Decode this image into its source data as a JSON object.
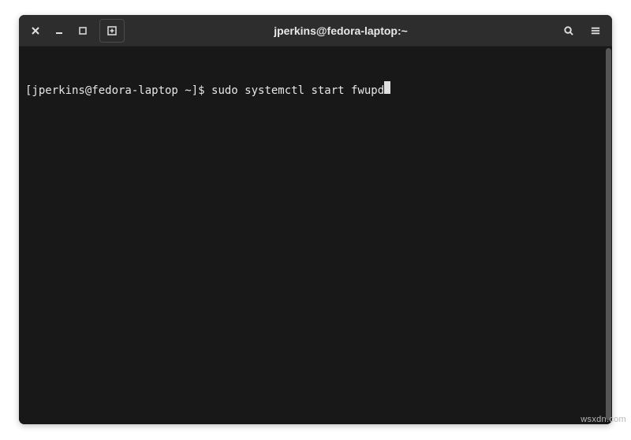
{
  "window": {
    "title": "jperkins@fedora-laptop:~"
  },
  "terminal": {
    "prompt": "[jperkins@fedora-laptop ~]$ ",
    "command": "sudo systemctl start fwupd"
  },
  "icons": {
    "close": "close-icon",
    "minimize": "minimize-icon",
    "maximize": "maximize-icon",
    "new_tab": "new-tab-icon",
    "search": "search-icon",
    "menu": "menu-icon"
  },
  "watermark": "wsxdn.com"
}
